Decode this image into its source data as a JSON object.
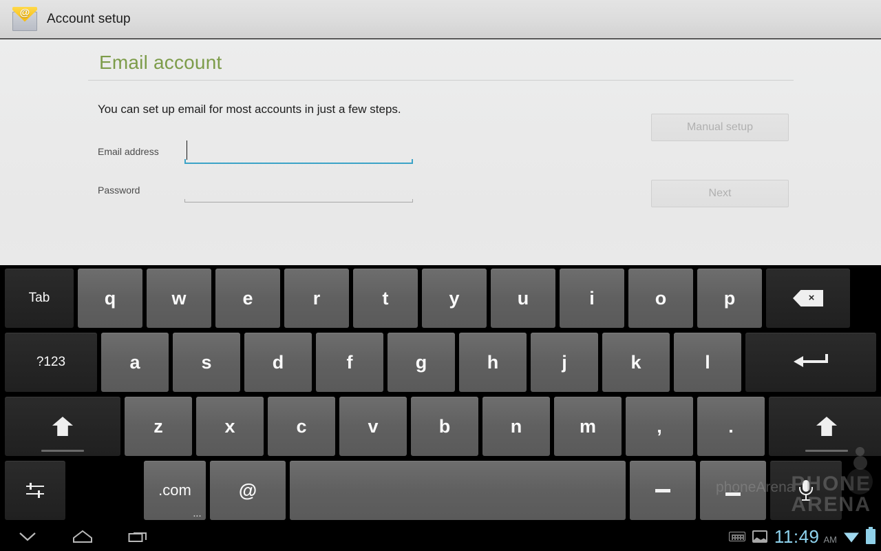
{
  "titlebar": {
    "icon": "email-envelope-at-icon",
    "at_symbol": "@",
    "title": "Account setup"
  },
  "content": {
    "page_title": "Email account",
    "intro": "You can set up email for most accounts in just a few steps.",
    "fields": [
      {
        "label": "Email address",
        "value": "",
        "placeholder": "",
        "focused": true
      },
      {
        "label": "Password",
        "value": "",
        "placeholder": "",
        "focused": false
      }
    ],
    "buttons": {
      "manual_setup": "Manual setup",
      "next": "Next"
    },
    "colors": {
      "title_green": "#7d9c4a",
      "focus_blue": "#3ba3c7",
      "content_bg": "#eaeaea",
      "disabled_text": "#b0b0b0"
    }
  },
  "keyboard": {
    "row1": [
      {
        "label": "Tab",
        "type": "fn"
      },
      {
        "label": "q",
        "type": "letter"
      },
      {
        "label": "w",
        "type": "letter"
      },
      {
        "label": "e",
        "type": "letter"
      },
      {
        "label": "r",
        "type": "letter"
      },
      {
        "label": "t",
        "type": "letter"
      },
      {
        "label": "y",
        "type": "letter"
      },
      {
        "label": "u",
        "type": "letter"
      },
      {
        "label": "i",
        "type": "letter"
      },
      {
        "label": "o",
        "type": "letter"
      },
      {
        "label": "p",
        "type": "letter"
      },
      {
        "label": "backspace-icon",
        "type": "fn"
      }
    ],
    "row2": [
      {
        "label": "?123",
        "type": "fn"
      },
      {
        "label": "a",
        "type": "letter"
      },
      {
        "label": "s",
        "type": "letter"
      },
      {
        "label": "d",
        "type": "letter"
      },
      {
        "label": "f",
        "type": "letter"
      },
      {
        "label": "g",
        "type": "letter"
      },
      {
        "label": "h",
        "type": "letter"
      },
      {
        "label": "j",
        "type": "letter"
      },
      {
        "label": "k",
        "type": "letter"
      },
      {
        "label": "l",
        "type": "letter"
      },
      {
        "label": "enter-icon",
        "type": "fn"
      }
    ],
    "row3": [
      {
        "label": "shift-icon",
        "type": "fn"
      },
      {
        "label": "z",
        "type": "letter"
      },
      {
        "label": "x",
        "type": "letter"
      },
      {
        "label": "c",
        "type": "letter"
      },
      {
        "label": "v",
        "type": "letter"
      },
      {
        "label": "b",
        "type": "letter"
      },
      {
        "label": "n",
        "type": "letter"
      },
      {
        "label": "m",
        "type": "letter"
      },
      {
        "label": ",",
        "type": "letter"
      },
      {
        "label": ".",
        "type": "letter"
      },
      {
        "label": "shift-icon",
        "type": "fn"
      }
    ],
    "row4": [
      {
        "label": "settings-icon",
        "type": "fn"
      },
      {
        "label": ".com",
        "type": "letter",
        "hint": "..."
      },
      {
        "label": "@",
        "type": "letter"
      },
      {
        "label": "space",
        "type": "letter"
      },
      {
        "label": "-",
        "type": "letter"
      },
      {
        "label": "_",
        "type": "letter"
      },
      {
        "label": "mic-icon",
        "type": "fn"
      }
    ]
  },
  "navbar": {
    "back": "back-down-icon",
    "home": "home-icon",
    "recents": "recent-apps-icon",
    "status": {
      "keyboard_indicator": "keyboard-status-icon",
      "screenshot_indicator": "screenshot-icon",
      "time": "11:49",
      "ampm": "AM",
      "wifi": "wifi-icon",
      "battery": "battery-icon"
    }
  },
  "watermark": {
    "text": "phoneArena",
    "logo_line1": "PHONE",
    "logo_line2": "ARENA"
  }
}
